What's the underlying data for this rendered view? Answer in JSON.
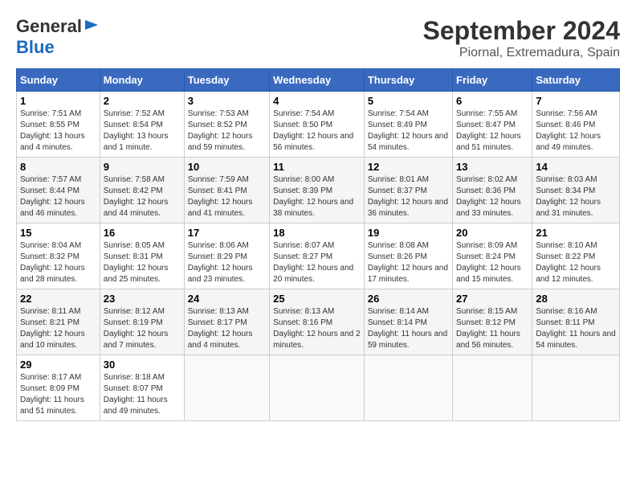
{
  "logo": {
    "general": "General",
    "blue": "Blue"
  },
  "title": "September 2024",
  "subtitle": "Piornal, Extremadura, Spain",
  "headers": [
    "Sunday",
    "Monday",
    "Tuesday",
    "Wednesday",
    "Thursday",
    "Friday",
    "Saturday"
  ],
  "weeks": [
    [
      {
        "day": "1",
        "sunrise": "7:51 AM",
        "sunset": "8:55 PM",
        "daylight": "13 hours and 4 minutes."
      },
      {
        "day": "2",
        "sunrise": "7:52 AM",
        "sunset": "8:54 PM",
        "daylight": "13 hours and 1 minute."
      },
      {
        "day": "3",
        "sunrise": "7:53 AM",
        "sunset": "8:52 PM",
        "daylight": "12 hours and 59 minutes."
      },
      {
        "day": "4",
        "sunrise": "7:54 AM",
        "sunset": "8:50 PM",
        "daylight": "12 hours and 56 minutes."
      },
      {
        "day": "5",
        "sunrise": "7:54 AM",
        "sunset": "8:49 PM",
        "daylight": "12 hours and 54 minutes."
      },
      {
        "day": "6",
        "sunrise": "7:55 AM",
        "sunset": "8:47 PM",
        "daylight": "12 hours and 51 minutes."
      },
      {
        "day": "7",
        "sunrise": "7:56 AM",
        "sunset": "8:46 PM",
        "daylight": "12 hours and 49 minutes."
      }
    ],
    [
      {
        "day": "8",
        "sunrise": "7:57 AM",
        "sunset": "8:44 PM",
        "daylight": "12 hours and 46 minutes."
      },
      {
        "day": "9",
        "sunrise": "7:58 AM",
        "sunset": "8:42 PM",
        "daylight": "12 hours and 44 minutes."
      },
      {
        "day": "10",
        "sunrise": "7:59 AM",
        "sunset": "8:41 PM",
        "daylight": "12 hours and 41 minutes."
      },
      {
        "day": "11",
        "sunrise": "8:00 AM",
        "sunset": "8:39 PM",
        "daylight": "12 hours and 38 minutes."
      },
      {
        "day": "12",
        "sunrise": "8:01 AM",
        "sunset": "8:37 PM",
        "daylight": "12 hours and 36 minutes."
      },
      {
        "day": "13",
        "sunrise": "8:02 AM",
        "sunset": "8:36 PM",
        "daylight": "12 hours and 33 minutes."
      },
      {
        "day": "14",
        "sunrise": "8:03 AM",
        "sunset": "8:34 PM",
        "daylight": "12 hours and 31 minutes."
      }
    ],
    [
      {
        "day": "15",
        "sunrise": "8:04 AM",
        "sunset": "8:32 PM",
        "daylight": "12 hours and 28 minutes."
      },
      {
        "day": "16",
        "sunrise": "8:05 AM",
        "sunset": "8:31 PM",
        "daylight": "12 hours and 25 minutes."
      },
      {
        "day": "17",
        "sunrise": "8:06 AM",
        "sunset": "8:29 PM",
        "daylight": "12 hours and 23 minutes."
      },
      {
        "day": "18",
        "sunrise": "8:07 AM",
        "sunset": "8:27 PM",
        "daylight": "12 hours and 20 minutes."
      },
      {
        "day": "19",
        "sunrise": "8:08 AM",
        "sunset": "8:26 PM",
        "daylight": "12 hours and 17 minutes."
      },
      {
        "day": "20",
        "sunrise": "8:09 AM",
        "sunset": "8:24 PM",
        "daylight": "12 hours and 15 minutes."
      },
      {
        "day": "21",
        "sunrise": "8:10 AM",
        "sunset": "8:22 PM",
        "daylight": "12 hours and 12 minutes."
      }
    ],
    [
      {
        "day": "22",
        "sunrise": "8:11 AM",
        "sunset": "8:21 PM",
        "daylight": "12 hours and 10 minutes."
      },
      {
        "day": "23",
        "sunrise": "8:12 AM",
        "sunset": "8:19 PM",
        "daylight": "12 hours and 7 minutes."
      },
      {
        "day": "24",
        "sunrise": "8:13 AM",
        "sunset": "8:17 PM",
        "daylight": "12 hours and 4 minutes."
      },
      {
        "day": "25",
        "sunrise": "8:13 AM",
        "sunset": "8:16 PM",
        "daylight": "12 hours and 2 minutes."
      },
      {
        "day": "26",
        "sunrise": "8:14 AM",
        "sunset": "8:14 PM",
        "daylight": "11 hours and 59 minutes."
      },
      {
        "day": "27",
        "sunrise": "8:15 AM",
        "sunset": "8:12 PM",
        "daylight": "11 hours and 56 minutes."
      },
      {
        "day": "28",
        "sunrise": "8:16 AM",
        "sunset": "8:11 PM",
        "daylight": "11 hours and 54 minutes."
      }
    ],
    [
      {
        "day": "29",
        "sunrise": "8:17 AM",
        "sunset": "8:09 PM",
        "daylight": "11 hours and 51 minutes."
      },
      {
        "day": "30",
        "sunrise": "8:18 AM",
        "sunset": "8:07 PM",
        "daylight": "11 hours and 49 minutes."
      },
      null,
      null,
      null,
      null,
      null
    ]
  ],
  "labels": {
    "sunrise_prefix": "Sunrise: ",
    "sunset_prefix": "Sunset: ",
    "daylight_prefix": "Daylight: "
  }
}
